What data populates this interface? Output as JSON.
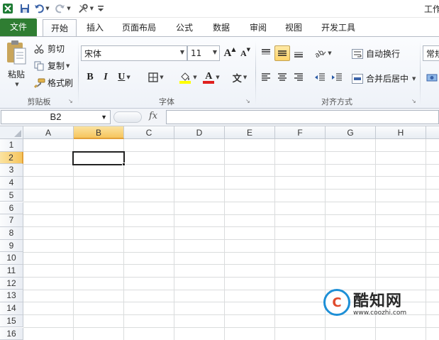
{
  "window": {
    "title_partial": "工作"
  },
  "quick_access": {
    "app_icon": "excel-icon",
    "save_icon": "save-icon",
    "undo_icon": "undo-icon",
    "redo_icon": "redo-icon",
    "customize_icon": "tools-icon",
    "menu_icon": "customize-qat-icon"
  },
  "tabs": [
    {
      "label": "文件"
    },
    {
      "label": "开始"
    },
    {
      "label": "插入"
    },
    {
      "label": "页面布局"
    },
    {
      "label": "公式"
    },
    {
      "label": "数据"
    },
    {
      "label": "审阅"
    },
    {
      "label": "视图"
    },
    {
      "label": "开发工具"
    }
  ],
  "clipboard": {
    "paste_label": "粘贴",
    "cut_label": "剪切",
    "copy_label": "复制",
    "format_painter_label": "格式刷",
    "group_label": "剪贴板"
  },
  "font": {
    "font_name": "宋体",
    "font_size": "11",
    "grow_label": "A",
    "shrink_label": "A",
    "bold_label": "B",
    "italic_label": "I",
    "underline_label": "U",
    "font_color_label": "A",
    "phonetic_label": "文",
    "group_label": "字体",
    "fill_color": "#ffff00",
    "text_color": "#e0201e"
  },
  "alignment": {
    "wrap_label": "自动换行",
    "merge_label": "合并后居中",
    "group_label": "对齐方式"
  },
  "number": {
    "format_partial": "常规"
  },
  "formula_bar": {
    "name_box": "B2",
    "fx_label": "fx",
    "formula": ""
  },
  "sheet": {
    "columns": [
      "A",
      "B",
      "C",
      "D",
      "E",
      "F",
      "G",
      "H"
    ],
    "rows": [
      "1",
      "2",
      "3",
      "4",
      "5",
      "6",
      "7",
      "8",
      "9",
      "10",
      "11",
      "12",
      "13",
      "14",
      "15",
      "16"
    ],
    "selected_cell": "B2",
    "selected_column": "B",
    "selected_row": "2"
  },
  "watermark": {
    "name": "酷知网",
    "url": "www.coozhi.com"
  }
}
